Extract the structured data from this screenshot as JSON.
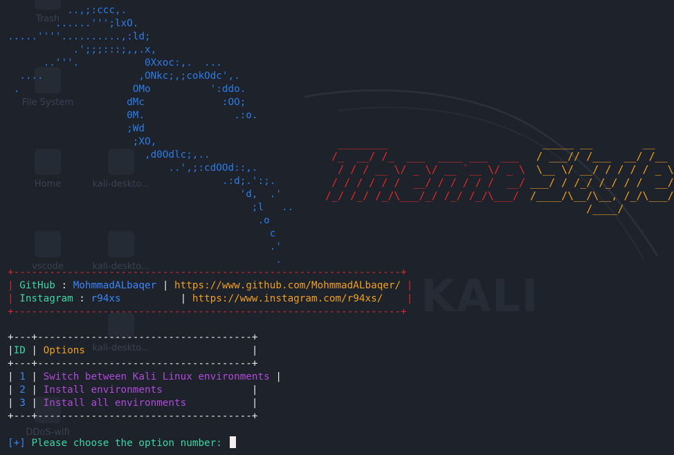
{
  "desktop_icons": [
    {
      "label": "Trash"
    },
    {
      "label": "File System"
    },
    {
      "label": "Home"
    },
    {
      "label": "kali-deskto..."
    },
    {
      "label": "vscode"
    },
    {
      "label": "kali-deskto..."
    },
    {
      "label": "kali-deskto..."
    },
    {
      "label": "DDoS-wifi"
    }
  ],
  "watermark": "KALI",
  "ascii_logo": "          ..,;:ccc,.\n        ......''';lxO.\n.....''''..........,:ld;\n           .';;;:::;,,.x,\n      ..'''.           0Xxoc:,.  ...\n  ....                ,ONkc;,;cokOdc',.\n .                   OMo          ':ddo.\n                    dMc             :OO;\n                    0M.               .:o.\n                    ;Wd\n                     ;XO,\n                       ,d0Odlc;,..\n                           ..',;:cdOOd::,.\n                                    .:d;.':;.\n                                       'd,  .'\n                                         ;l   ..\n                                          .o\n                                            c\n                                            .'\n                                             .",
  "title_art": {
    "theme": "    ________\n   /_  __/ /_  ___  ____ ___  ___\n    / / / __ \\/ _ \\/ __ `__ \\/ _ \\\n   / / / / / /  __/ / / / / /  __/\n  /_/ /_/ /_/\\___/_/ /_/ /_/\\___/",
    "style": "  _____ __        __\n / ___// /___  __/ /__\n \\__ \\/ __/ / / / / _ \\\n___/ / /_/ /_/ / /  __/\n/____/\\__/\\__, /_/\\___/\n         /____/"
  },
  "contact": {
    "border": "+-----------------------------------------------------------------+",
    "rows": [
      {
        "label": "GitHub",
        "value": "MohmmadALbaqer",
        "url": "https://www.github.com/MohmmadALbaqer/"
      },
      {
        "label": "Instagram",
        "value": "r94xs",
        "url": "https://www.instagram.com/r94xs/"
      }
    ]
  },
  "menu": {
    "border": "+---+------------------------------------+",
    "id_header": "ID",
    "options_header": "Options",
    "items": [
      {
        "id": "1",
        "label": "Switch between Kali Linux environments"
      },
      {
        "id": "2",
        "label": "Install environments"
      },
      {
        "id": "3",
        "label": "Install all environments"
      }
    ]
  },
  "prompt": {
    "marker": "[+]",
    "text": "Please choose the option number:",
    "value": ""
  }
}
